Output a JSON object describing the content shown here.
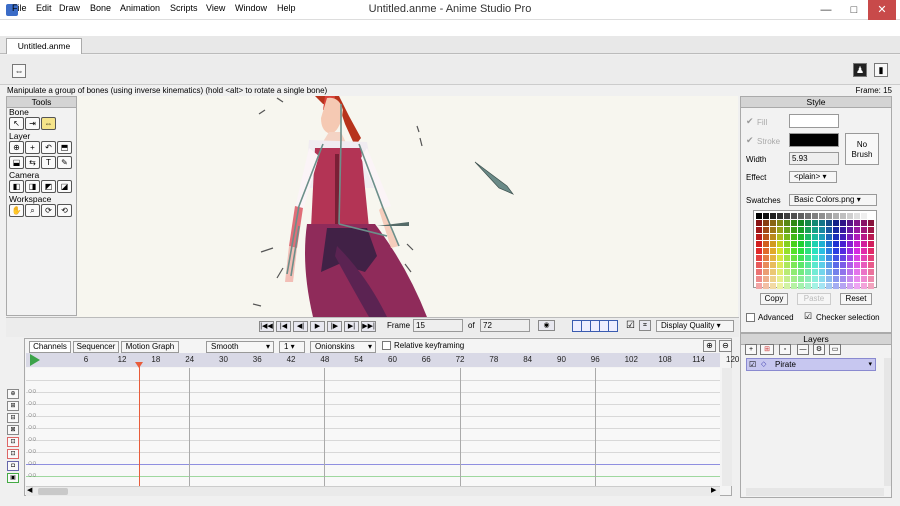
{
  "window": {
    "title": "Untitled.anme - Anime Studio Pro",
    "minimize": "—",
    "maximize": "□",
    "close": "✕"
  },
  "menu": [
    "File",
    "Edit",
    "Draw",
    "Bone",
    "Animation",
    "Scripts",
    "View",
    "Window",
    "Help"
  ],
  "document_tab": "Untitled.anme",
  "status": {
    "message": "Manipulate a group of bones (using inverse kinematics) (hold <alt> to rotate a single bone)",
    "frame": "Frame: 15"
  },
  "tools": {
    "title": "Tools",
    "sections": [
      {
        "label": "Bone",
        "rows": [
          [
            "select-bone-icon",
            "translate-bone-icon",
            "manipulate-bones-icon"
          ]
        ]
      },
      {
        "label": "Layer",
        "rows": [
          [
            "transform-layer-icon",
            "set-origin-icon",
            "rotate-layer-icon",
            "scale-layer-icon"
          ],
          [
            "shear-layer-icon",
            "switch-layer-icon",
            "text-icon",
            "eyedropper-icon"
          ]
        ]
      },
      {
        "label": "Camera",
        "rows": [
          [
            "camera-track-icon",
            "camera-zoom-icon",
            "camera-roll-icon",
            "camera-pan-icon"
          ]
        ]
      },
      {
        "label": "Workspace",
        "rows": [
          [
            "pan-hand-icon",
            "zoom-icon",
            "rotate-view-icon",
            "orbit-icon"
          ]
        ]
      }
    ]
  },
  "playback": {
    "frame_label": "Frame",
    "frame_value": "15",
    "of_label": "of",
    "total_frames": "72",
    "display_quality": "Display Quality"
  },
  "timeline": {
    "tabs": [
      "Channels",
      "Sequencer",
      "Motion Graph"
    ],
    "interpolation": "Smooth",
    "keyframe_step": "1",
    "onionskins": "Onionskins",
    "relative_keyframing": "Relative keyframing",
    "ruler": [
      "0",
      "6",
      "12",
      "18",
      "24",
      "30",
      "36",
      "42",
      "48",
      "54",
      "60",
      "66",
      "72",
      "78",
      "84",
      "90",
      "96",
      "102",
      "108",
      "114",
      "120"
    ],
    "current_frame": 15
  },
  "style": {
    "title": "Style",
    "fill_label": "Fill",
    "stroke_label": "Stroke",
    "width_label": "Width",
    "width_value": "5.93",
    "no_brush": "No Brush",
    "effect_label": "Effect",
    "effect_value": "<plain>",
    "swatches_label": "Swatches",
    "swatches_value": "Basic Colors.png",
    "copy": "Copy",
    "paste": "Paste",
    "reset": "Reset",
    "advanced": "Advanced",
    "checker_selection": "Checker selection",
    "fill_color": "#ffffff",
    "stroke_color": "#000000"
  },
  "layers": {
    "title": "Layers",
    "items": [
      {
        "name": "Pirate",
        "type": "bone-layer"
      }
    ]
  },
  "colors": {
    "accent": "#4a6bd6",
    "playhead": "#e85c3a",
    "layer_selected": "#c7c7f0"
  }
}
